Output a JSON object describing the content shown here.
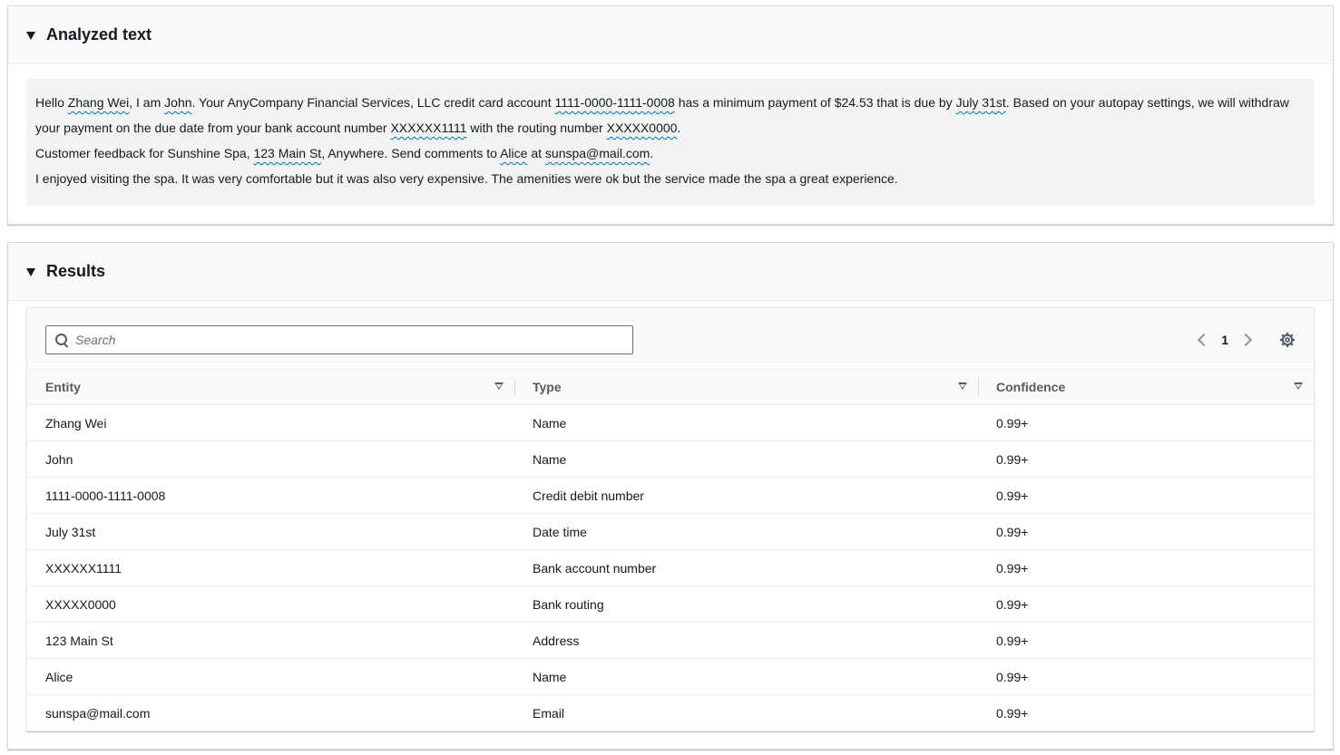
{
  "analyzed": {
    "title": "Analyzed text",
    "paragraphs": [
      [
        {
          "t": "Hello "
        },
        {
          "t": "Zhang Wei",
          "e": true
        },
        {
          "t": ", I am "
        },
        {
          "t": "John",
          "e": true
        },
        {
          "t": ". Your AnyCompany Financial Services, LLC credit card account "
        },
        {
          "t": "1111-0000-1111-0008",
          "e": true
        },
        {
          "t": " has a minimum payment of $24.53 that is due by "
        },
        {
          "t": "July 31st",
          "e": true
        },
        {
          "t": ". Based on your autopay settings, we will withdraw your payment on the due date from your bank account number "
        },
        {
          "t": "XXXXXX1111",
          "e": true
        },
        {
          "t": " with the routing number "
        },
        {
          "t": "XXXXX0000",
          "e": true
        },
        {
          "t": "."
        }
      ],
      [
        {
          "t": "Customer feedback for Sunshine Spa, "
        },
        {
          "t": "123 Main St",
          "e": true
        },
        {
          "t": ", Anywhere. Send comments to "
        },
        {
          "t": "Alice",
          "e": true
        },
        {
          "t": " at "
        },
        {
          "t": "sunspa@mail.com",
          "e": true
        },
        {
          "t": "."
        }
      ],
      [
        {
          "t": "I enjoyed visiting the spa. It was very comfortable but it was also very expensive. The amenities were ok but the service made the spa a great experience."
        }
      ]
    ]
  },
  "results": {
    "title": "Results",
    "search": {
      "placeholder": "Search"
    },
    "pagination": {
      "current": "1"
    },
    "columns": {
      "entity": "Entity",
      "type": "Type",
      "confidence": "Confidence"
    },
    "rows": [
      {
        "entity": "Zhang Wei",
        "type": "Name",
        "confidence": "0.99+"
      },
      {
        "entity": "John",
        "type": "Name",
        "confidence": "0.99+"
      },
      {
        "entity": "1111-0000-1111-0008",
        "type": "Credit debit number",
        "confidence": "0.99+"
      },
      {
        "entity": "July 31st",
        "type": "Date time",
        "confidence": "0.99+"
      },
      {
        "entity": "XXXXXX1111",
        "type": "Bank account number",
        "confidence": "0.99+"
      },
      {
        "entity": "XXXXX0000",
        "type": "Bank routing",
        "confidence": "0.99+"
      },
      {
        "entity": "123 Main St",
        "type": "Address",
        "confidence": "0.99+"
      },
      {
        "entity": "Alice",
        "type": "Name",
        "confidence": "0.99+"
      },
      {
        "entity": "sunspa@mail.com",
        "type": "Email",
        "confidence": "0.99+"
      }
    ]
  },
  "icons": {
    "expand": "caret-down-icon",
    "search": "search-icon",
    "prev": "chevron-left-icon",
    "next": "chevron-right-icon",
    "settings": "gear-icon",
    "sort": "sort-caret-icon"
  },
  "colors": {
    "entity_underline": "#0073bb",
    "text_box_bg": "#f2f3f3",
    "header_bg": "#fafafa"
  }
}
